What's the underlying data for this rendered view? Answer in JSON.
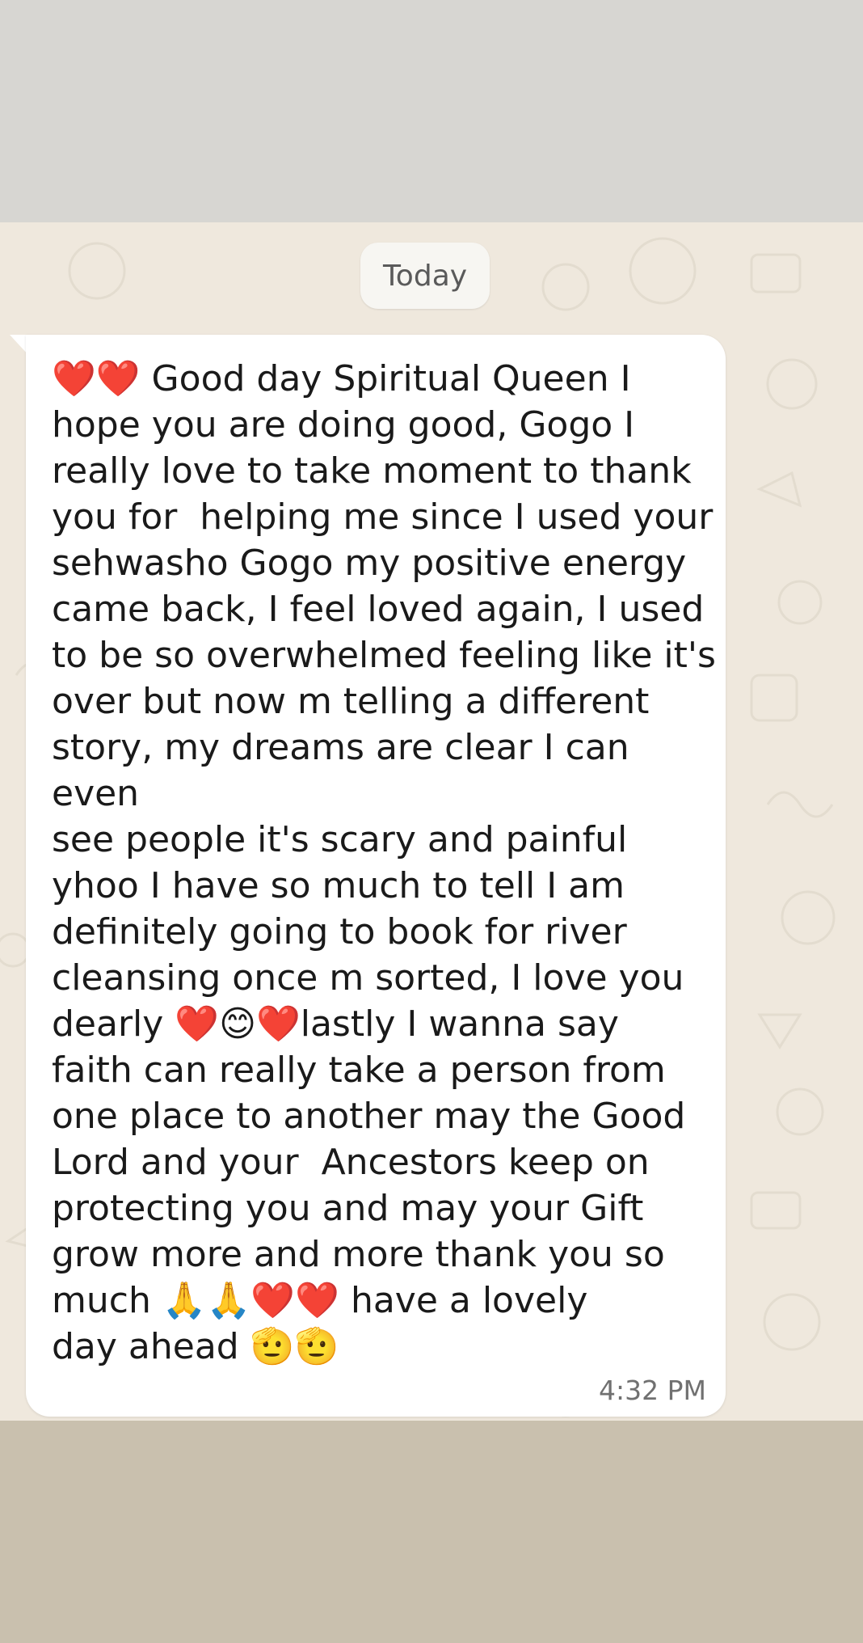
{
  "chat": {
    "date_separator": "Today",
    "message": {
      "text": "❤️❤️ Good day Spiritual Queen I\nhope you are doing good, Gogo I\nreally love to take moment to thank\nyou for  helping me since I used your\nsehwasho Gogo my positive energy\ncame back, I feel loved again, I used\nto be so overwhelmed feeling like it's\nover but now m telling a different\nstory, my dreams are clear I can even\nsee people it's scary and painful\nyhoo I have so much to tell I am\ndefinitely going to book for river\ncleansing once m sorted, I love you\ndearly ❤️😊❤️lastly I wanna say\nfaith can really take a person from\none place to another may the Good\nLord and your  Ancestors keep on\nprotecting you and may your Gift\ngrow more and more thank you so\nmuch 🙏🙏❤️❤️ have a lovely\nday ahead 🫡🫡",
      "time": "4:32 PM"
    }
  },
  "colors": {
    "top_band": "#d7d6d2",
    "chat_background": "#efe8dd",
    "bubble": "#ffffff",
    "bottom_band": "#c9c0ae",
    "time_text": "#707070"
  }
}
